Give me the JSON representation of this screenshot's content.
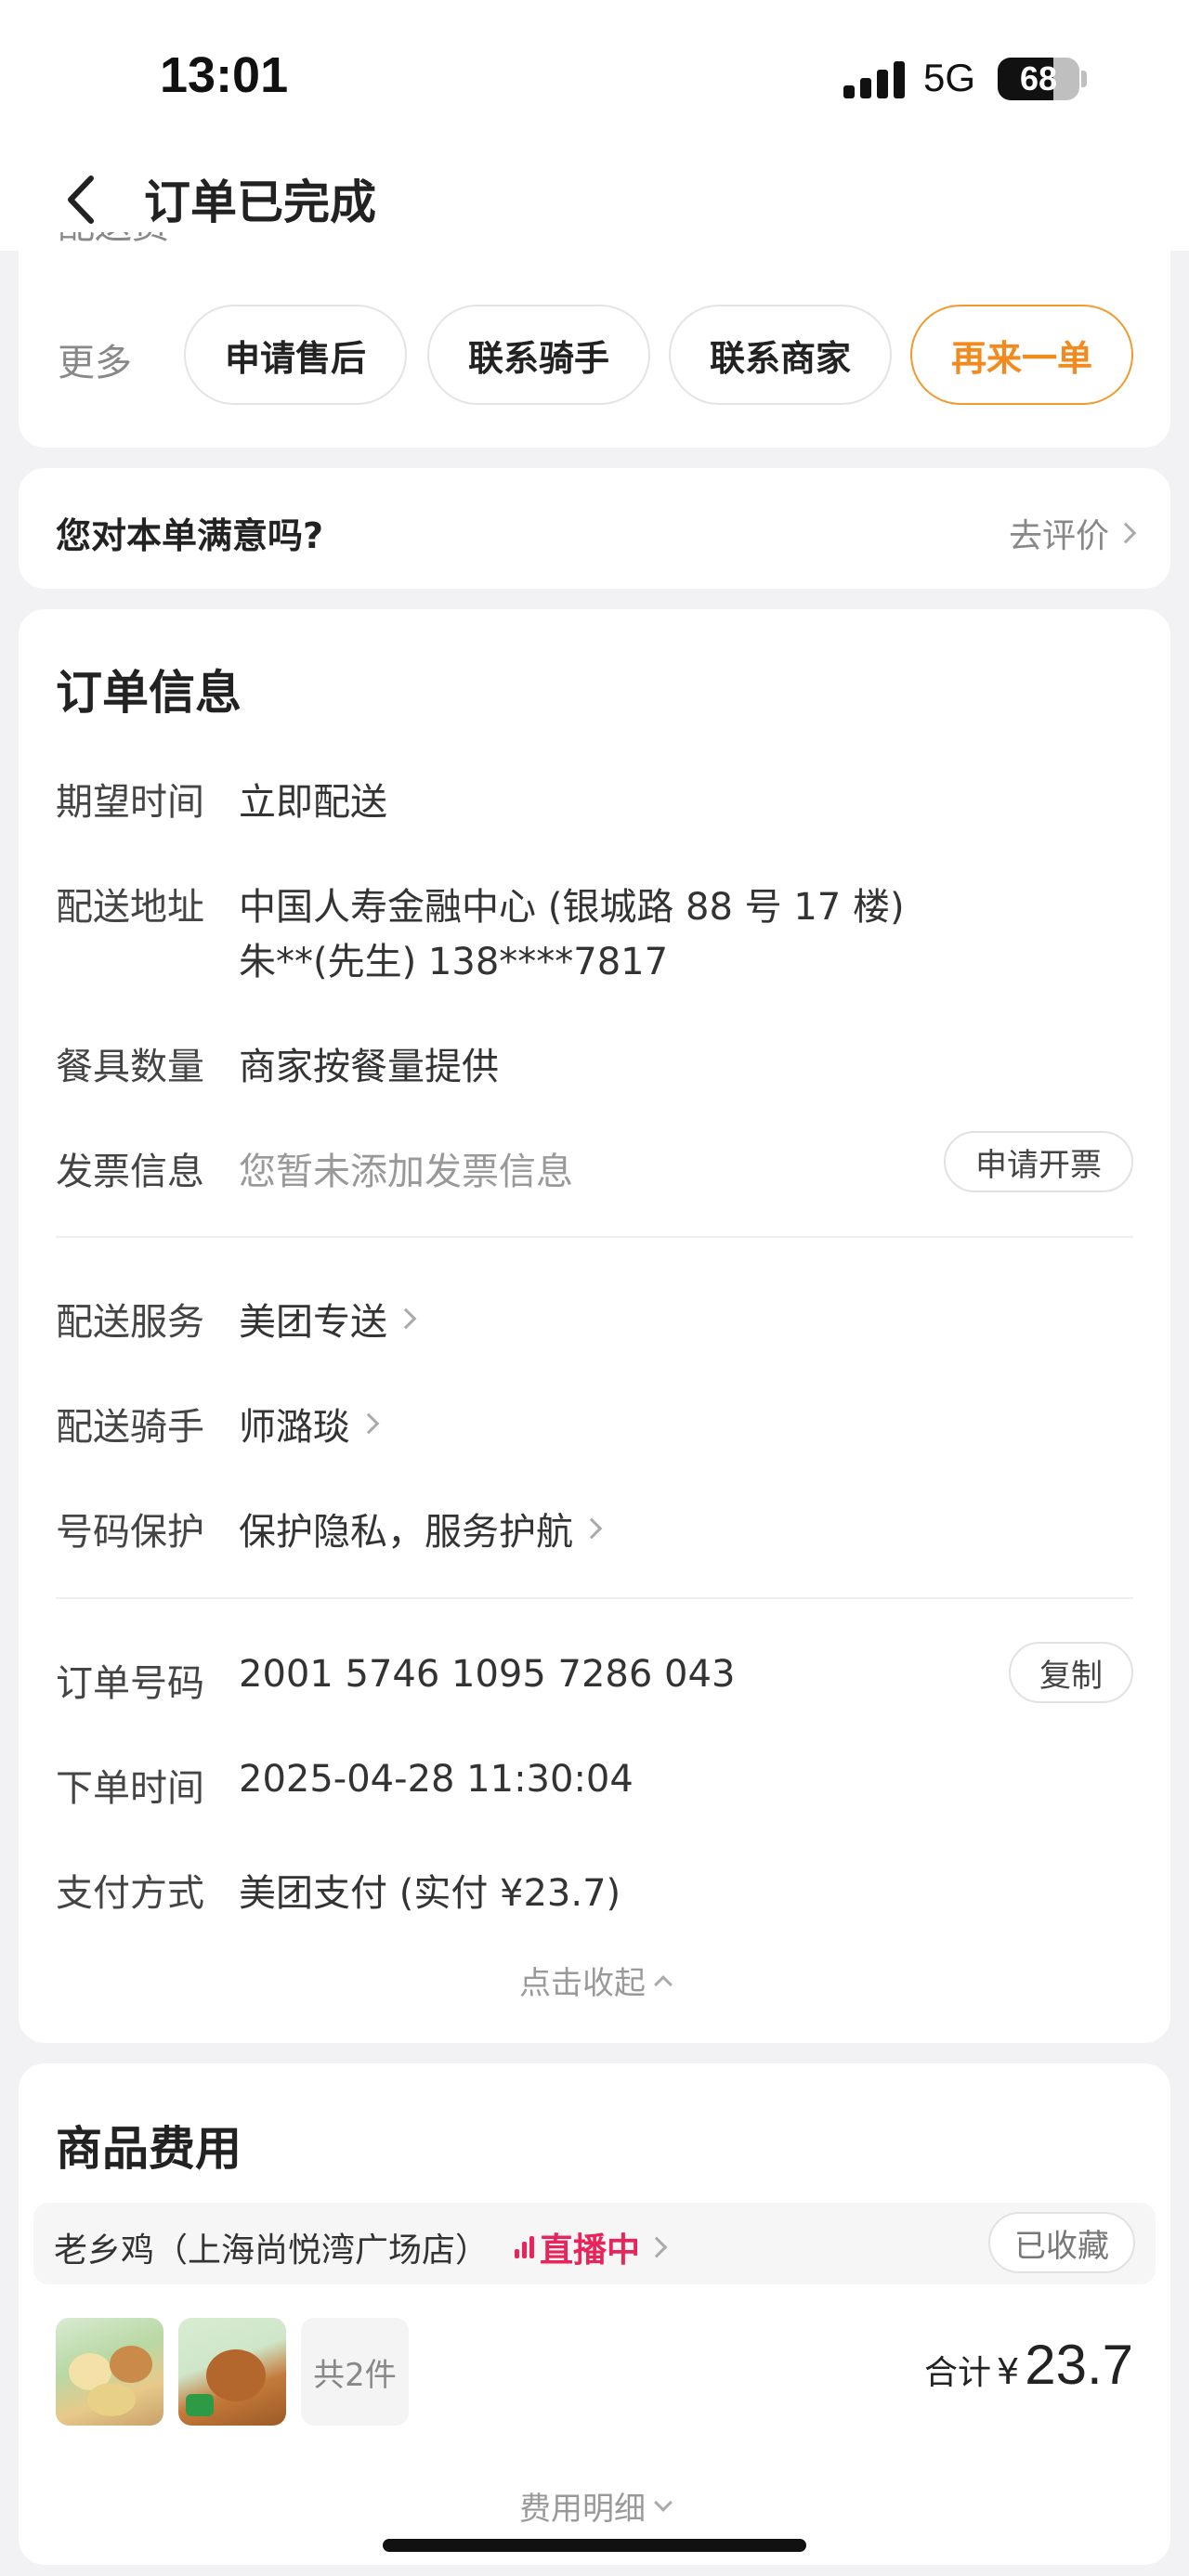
{
  "status_bar": {
    "time": "13:01",
    "network": "5G",
    "battery": "68",
    "battery_level": 0.68
  },
  "nav": {
    "title": "订单已完成"
  },
  "top_card": {
    "clipped_text": "配送费",
    "more_label": "更多",
    "actions": [
      "申请售后",
      "联系骑手",
      "联系商家",
      "再来一单"
    ]
  },
  "satisfaction": {
    "question": "您对本单满意吗?",
    "link": "去评价"
  },
  "order_info": {
    "title": "订单信息",
    "expected_time": {
      "label": "期望时间",
      "value": "立即配送"
    },
    "address": {
      "label": "配送地址",
      "line1": "中国人寿金融中心 (银城路 88 号 17 楼)",
      "line2": "朱**(先生) 138****7817"
    },
    "tableware": {
      "label": "餐具数量",
      "value": "商家按餐量提供"
    },
    "invoice": {
      "label": "发票信息",
      "value": "您暂未添加发票信息",
      "button": "申请开票"
    },
    "delivery_service": {
      "label": "配送服务",
      "value": "美团专送"
    },
    "rider": {
      "label": "配送骑手",
      "value": "师潞琰"
    },
    "number_protect": {
      "label": "号码保护",
      "value": "保护隐私，服务护航"
    },
    "order_no": {
      "label": "订单号码",
      "value": "2001 5746 1095 7286 043",
      "button": "复制"
    },
    "order_time": {
      "label": "下单时间",
      "value": "2025-04-28 11:30:04"
    },
    "payment": {
      "label": "支付方式",
      "value": "美团支付 (实付 ¥23.7)"
    },
    "collapse": "点击收起"
  },
  "goods": {
    "title": "商品费用",
    "store": "老乡鸡（上海尚悦湾广场店）",
    "live": "直播中",
    "favorite": "已收藏",
    "count": "共2件",
    "total_label": "合计",
    "currency": "¥",
    "total_amount": "23.7",
    "detail": "费用明细"
  }
}
